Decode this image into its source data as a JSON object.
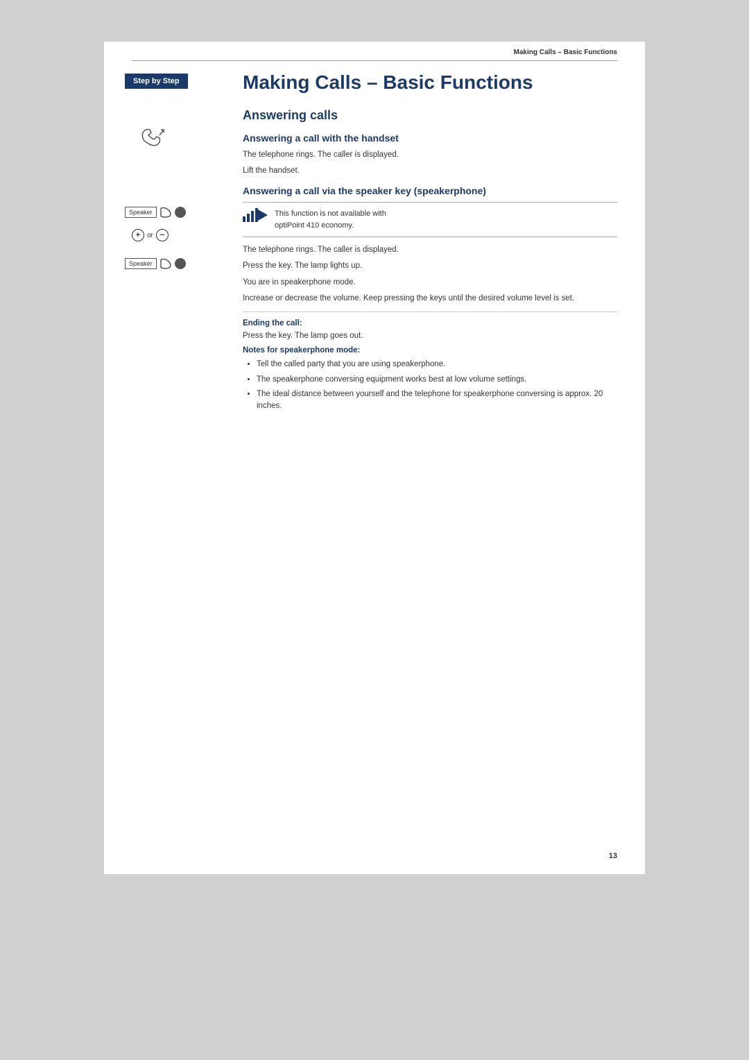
{
  "header": {
    "title": "Making Calls – Basic Functions",
    "rule": true
  },
  "sidebar": {
    "badge_label": "Step by Step"
  },
  "main": {
    "page_title": "Making Calls – Basic Functions",
    "section_answering": "Answering calls",
    "subsection_handset": "Answering a call with the handset",
    "handset_desc1": "The telephone rings. The caller is displayed.",
    "handset_desc2": "Lift the handset.",
    "subsection_speaker": "Answering a call via the speaker key (speakerphone)",
    "note_text1": "This function is not available with",
    "note_text2": "optiPoint 410 economy.",
    "speaker_desc1": "The telephone rings. The caller is displayed.",
    "speaker_desc2": "Press the key. The lamp lights up.",
    "speaker_desc3": "You are in speakerphone mode.",
    "volume_desc": "Increase or decrease the volume. Keep pressing the keys until the desired volume level is set.",
    "ending_label": "Ending the call:",
    "ending_desc": "Press the key. The lamp goes out.",
    "notes_label": "Notes for speakerphone mode:",
    "bullet1": "Tell the called party that you are using speakerphone.",
    "bullet2": "The speakerphone conversing equipment works best at low volume settings.",
    "bullet3": "The ideal distance between yourself and the telephone for speakerphone conversing is approx. 20 inches.",
    "speaker_btn_label": "Speaker",
    "or_label": "or",
    "page_number": "13"
  }
}
